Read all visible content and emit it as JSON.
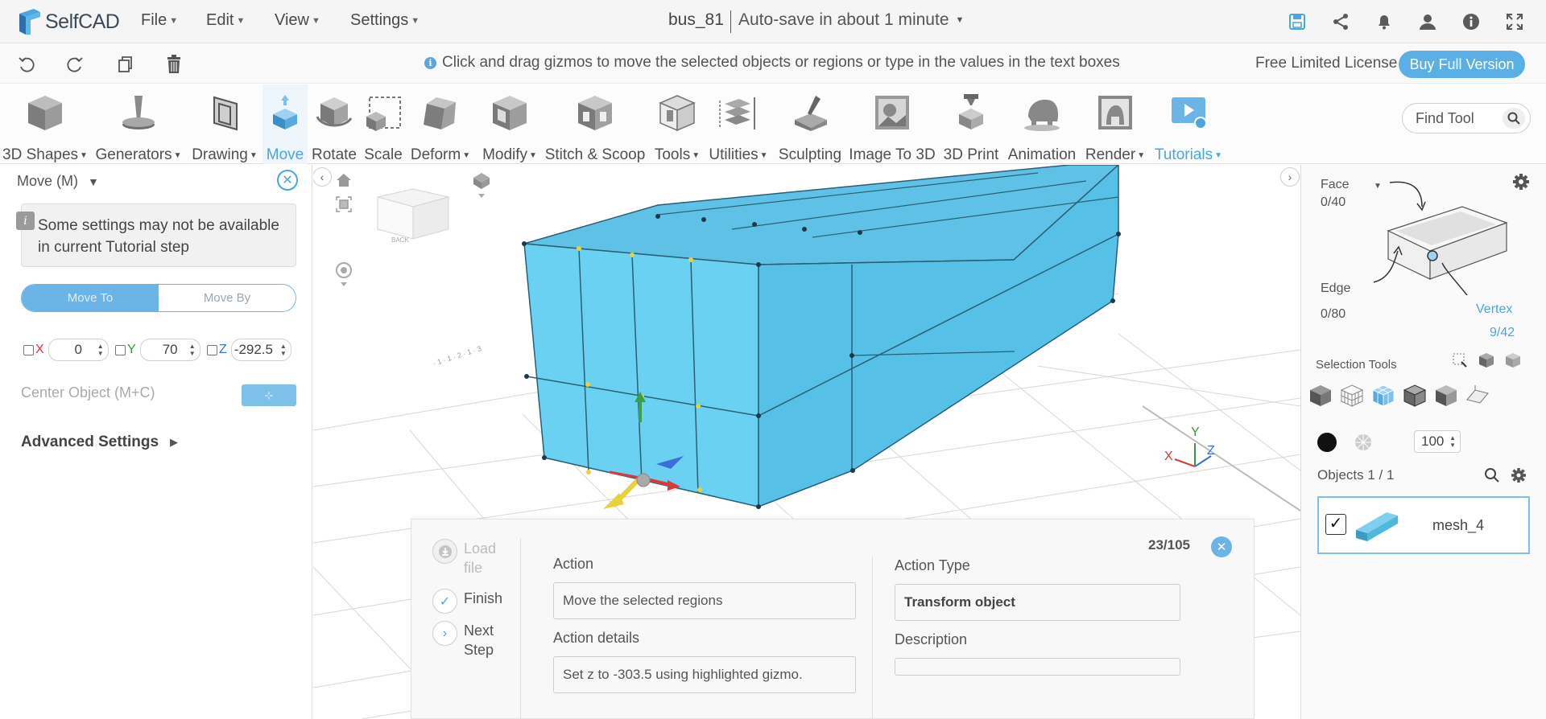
{
  "app": {
    "logo_text": "SelfCAD",
    "menus": [
      "File",
      "Edit",
      "View",
      "Settings"
    ],
    "doc_name": "bus_81",
    "autosave": "Auto-save in about 1 minute",
    "top_icons": [
      "save-icon",
      "share-icon",
      "bell-icon",
      "user-icon",
      "info-icon",
      "fullscreen-icon"
    ]
  },
  "bar2": {
    "hint": "Click and drag gizmos to move the selected objects or regions or type in the values in the text boxes",
    "license": "Free Limited License",
    "buy": "Buy Full Version"
  },
  "ribbon": {
    "tools": [
      {
        "label": "3D Shapes",
        "dropdown": true
      },
      {
        "label": "Generators",
        "dropdown": true
      },
      {
        "label": "Drawing",
        "dropdown": true
      },
      {
        "label": "Move",
        "dropdown": false,
        "active": true
      },
      {
        "label": "Rotate",
        "dropdown": false
      },
      {
        "label": "Scale",
        "dropdown": false
      },
      {
        "label": "Deform",
        "dropdown": true
      },
      {
        "label": "Modify",
        "dropdown": true
      },
      {
        "label": "Stitch & Scoop",
        "dropdown": false
      },
      {
        "label": "Tools",
        "dropdown": true
      },
      {
        "label": "Utilities",
        "dropdown": true
      },
      {
        "label": "Sculpting",
        "dropdown": false
      },
      {
        "label": "Image To 3D",
        "dropdown": false
      },
      {
        "label": "3D Print",
        "dropdown": false
      },
      {
        "label": "Animation",
        "dropdown": false
      },
      {
        "label": "Render",
        "dropdown": true
      },
      {
        "label": "Tutorials",
        "dropdown": true
      }
    ],
    "find_placeholder": "Find Tool"
  },
  "move_panel": {
    "title": "Move (M)",
    "notice": "Some settings may not be available in current Tutorial step",
    "mode_move_to": "Move To",
    "mode_move_by": "Move By",
    "x_label": "X",
    "x_value": "0",
    "y_label": "Y",
    "y_value": "70",
    "z_label": "Z",
    "z_value": "-292.5",
    "center_label": "Center Object (M+C)",
    "advanced": "Advanced Settings"
  },
  "viewcube": {
    "face": "BACK"
  },
  "axes": {
    "x": "X",
    "y": "Y",
    "z": "Z"
  },
  "tutorial": {
    "counter": "23/105",
    "steps": [
      {
        "label": "Load file",
        "state": "disabled"
      },
      {
        "label": "Finish",
        "state": "done"
      },
      {
        "label": "Next Step",
        "state": "next"
      }
    ],
    "action_label": "Action",
    "action_value": "Move the selected regions",
    "details_label": "Action details",
    "details_value": "Set z to -303.5 using highlighted gizmo.",
    "type_label": "Action Type",
    "type_value": "Transform object",
    "desc_label": "Description",
    "desc_value": ""
  },
  "selection": {
    "face_label": "Face",
    "face_count": "0/40",
    "edge_label": "Edge",
    "edge_count": "0/80",
    "vertex_label": "Vertex",
    "vertex_count": "9/42",
    "tools_label": "Selection Tools",
    "brush_size": "100",
    "objects_label": "Objects 1 / 1",
    "object_name": "mesh_4"
  },
  "colors": {
    "accent": "#4aa6e0",
    "mesh": "#6ad2f2",
    "mesh_dark": "#4fb9dc"
  }
}
